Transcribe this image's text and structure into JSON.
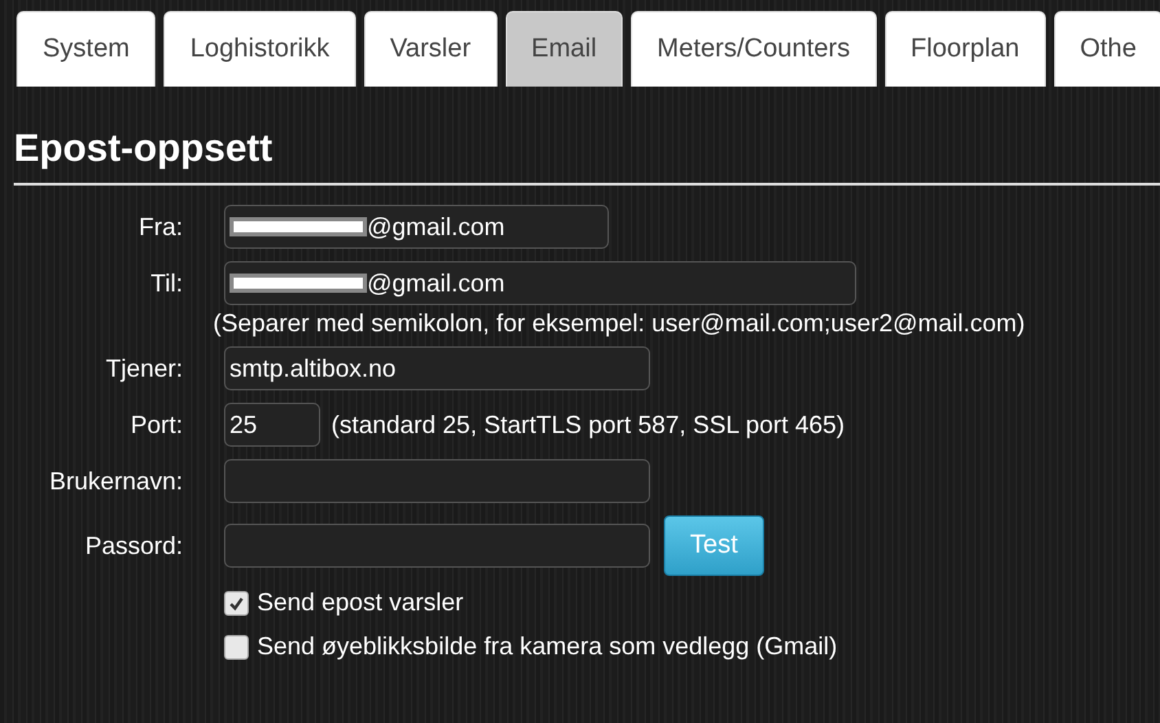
{
  "tabs": [
    {
      "label": "System",
      "selected": false
    },
    {
      "label": "Loghistorikk",
      "selected": false
    },
    {
      "label": "Varsler",
      "selected": false
    },
    {
      "label": "Email",
      "selected": true
    },
    {
      "label": "Meters/Counters",
      "selected": false
    },
    {
      "label": "Floorplan",
      "selected": false
    },
    {
      "label": "Othe",
      "selected": false
    }
  ],
  "heading": "Epost-oppsett",
  "rows": [
    {
      "kind": "field",
      "label": "Fra:",
      "value": "@gmail.com",
      "redacted": true
    },
    {
      "kind": "field",
      "label": "Til:",
      "value": "@gmail.com",
      "redacted": true
    },
    {
      "kind": "hint",
      "text": "(Separer med semikolon, for eksempel: user@mail.com;user2@mail.com)"
    },
    {
      "kind": "field",
      "label": "Tjener:",
      "value": "smtp.altibox.no",
      "redacted": false
    },
    {
      "kind": "field",
      "label": "Port:",
      "value": "25",
      "redacted": false,
      "note": "(standard 25, StartTLS port 587, SSL port 465)"
    },
    {
      "kind": "field",
      "label": "Brukernavn:",
      "value": "",
      "redacted": false
    },
    {
      "kind": "field",
      "label": "Passord:",
      "value": "",
      "redacted": false,
      "button": "Test"
    }
  ],
  "checkboxes": [
    {
      "label": "Send epost varsler",
      "checked": true
    },
    {
      "label": "Send øyeblikksbilde fra kamera som vedlegg (Gmail)",
      "checked": false
    }
  ]
}
